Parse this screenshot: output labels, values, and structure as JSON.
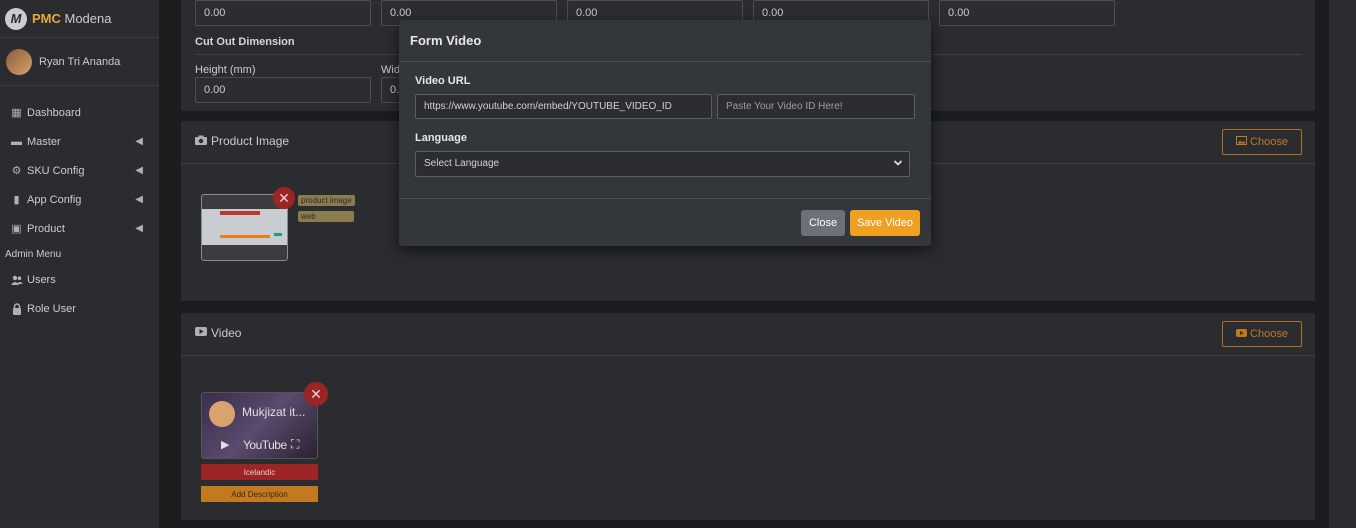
{
  "brand": {
    "name_bold": "PMC",
    "name_rest": " Modena",
    "logo_letter": "M"
  },
  "user": {
    "name": "Ryan Tri Ananda"
  },
  "nav": {
    "items": [
      {
        "label": "Dashboard",
        "icon": "dashboard-icon",
        "glyph": "▦",
        "has_children": false
      },
      {
        "label": "Master",
        "icon": "database-icon",
        "glyph": "▬",
        "has_children": true
      },
      {
        "label": "SKU Config",
        "icon": "gear-icon",
        "glyph": "⚙",
        "has_children": true
      },
      {
        "label": "App Config",
        "icon": "mobile-icon",
        "glyph": "▮",
        "has_children": true
      },
      {
        "label": "Product",
        "icon": "briefcase-icon",
        "glyph": "▣",
        "has_children": true
      }
    ],
    "admin_header": "Admin Menu",
    "admin_items": [
      {
        "label": "Users",
        "icon": "users-icon",
        "glyph": "👥"
      },
      {
        "label": "Role User",
        "icon": "lock-icon",
        "glyph": "🔒"
      }
    ]
  },
  "dimensions": {
    "top_values": [
      "0.00",
      "0.00",
      "0.00",
      "0.00",
      "0.00"
    ],
    "cut_out_title": "Cut Out Dimension",
    "height_label": "Height (mm)",
    "height_value": "0.00",
    "width_label_partial": "Wid",
    "width_value_partial": "0."
  },
  "product_image": {
    "title": "Product Image",
    "choose_label": "Choose",
    "tags": [
      "product image",
      "web"
    ],
    "remove_glyph": "✕"
  },
  "video": {
    "title": "Video",
    "choose_label": "Choose",
    "thumb_title": "Mukjizat it...",
    "thumb_brand": "YouTube",
    "language_badge": "Icelandic",
    "add_description": "Add Description",
    "remove_glyph": "✕"
  },
  "modal": {
    "title": "Form Video",
    "url_label": "Video URL",
    "url_value": "https://www.youtube.com/embed/YOUTUBE_VIDEO_ID",
    "id_placeholder": "Paste Your Video ID Here!",
    "language_label": "Language",
    "language_selected": "Select Language",
    "close_label": "Close",
    "save_label": "Save Video"
  },
  "colors": {
    "accent": "#f0a020",
    "danger": "#9b2525",
    "background": "#1b1c1e",
    "panel": "#2a2c30"
  }
}
